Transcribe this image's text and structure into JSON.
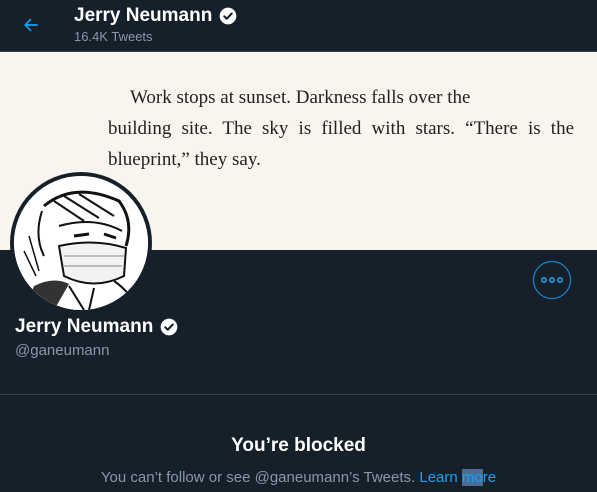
{
  "header": {
    "name": "Jerry Neumann",
    "tweet_count": "16.4K Tweets",
    "back_icon": "arrow-left-icon",
    "verified_icon": "verified-badge-icon"
  },
  "banner": {
    "line1": "Work stops at sunset. Darkness falls over the",
    "line2": "building site. The sky is filled with stars. “There is",
    "line3": "the blueprint,” they say."
  },
  "profile": {
    "name": "Jerry Neumann",
    "handle": "@ganeumann",
    "more_icon": "more-options-icon"
  },
  "blocked": {
    "title": "You’re blocked",
    "message": "You can’t follow or see @ganeumann’s Tweets. ",
    "link_a": "Learn ",
    "link_b": "mo",
    "link_c": "re"
  },
  "colors": {
    "background": "#15202b",
    "accent": "#1da1f2",
    "muted_text": "#8899a6",
    "border": "#38444d"
  }
}
